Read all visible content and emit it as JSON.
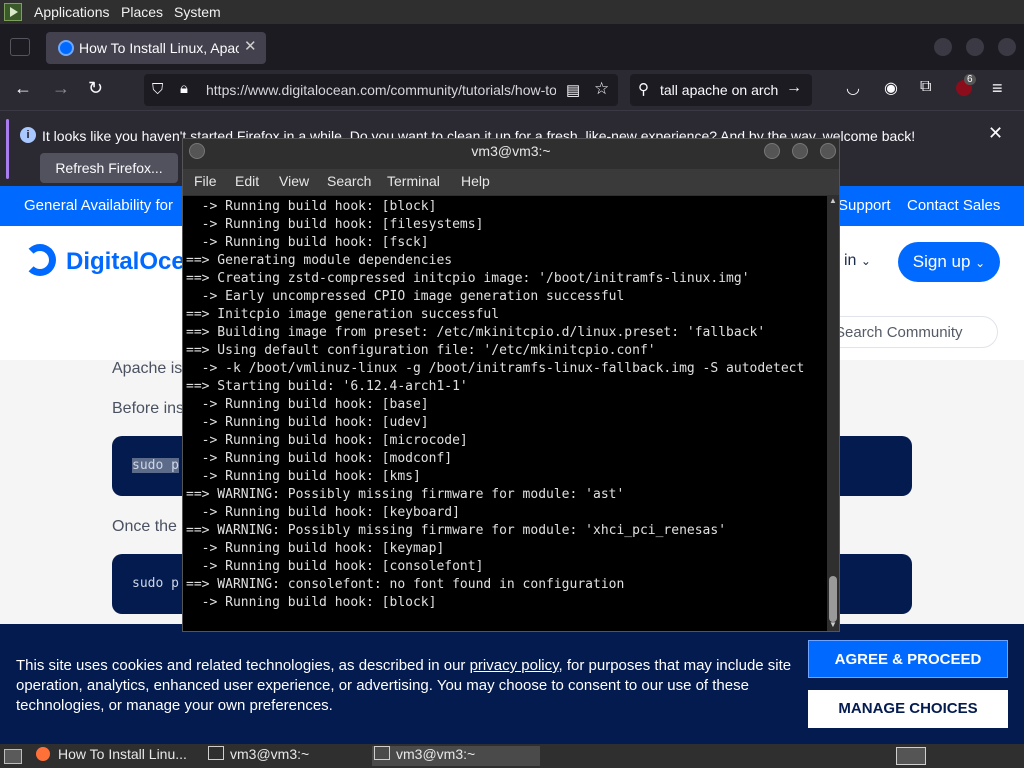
{
  "top_panel": {
    "menus": [
      "Applications",
      "Places",
      "System"
    ]
  },
  "browser": {
    "tab_title": "How To Install Linux, Apache, MySQL, PHP",
    "url": "https://www.digitalocean.com/community/tutorials/how-to-install-linux-apache",
    "search_text": "tall apache on arch",
    "extension_badge": "6",
    "notice": "It looks like you haven't started Firefox in a while. Do you want to clean it up for a fresh, like-new experience? And by the way, welcome back!",
    "refresh_label": "Refresh Firefox..."
  },
  "page": {
    "banner_left": "General Availability for",
    "banner_support": "Support",
    "banner_contact": "Contact Sales",
    "logo_text": "DigitalOce",
    "signin_text": "in",
    "signup_label": "Sign up",
    "search_placeholder": "Search Community",
    "para1": "Apache is",
    "para2": "Before ins",
    "para3": "Once the",
    "code1": "sudo p",
    "code2": "sudo p"
  },
  "cookie": {
    "text_before": "This site uses cookies and related technologies, as described in our ",
    "link": "privacy policy",
    "text_after": ", for purposes that may include site operation, analytics, enhanced user experience, or advertising. You may choose to consent to our use of these technologies, or manage your own preferences.",
    "agree": "AGREE & PROCEED",
    "manage": "MANAGE CHOICES"
  },
  "terminal": {
    "title": "vm3@vm3:~",
    "menus": [
      "File",
      "Edit",
      "View",
      "Search",
      "Terminal",
      "Help"
    ],
    "lines": [
      "  -> Running build hook: [block]",
      "  -> Running build hook: [filesystems]",
      "  -> Running build hook: [fsck]",
      "==> Generating module dependencies",
      "==> Creating zstd-compressed initcpio image: '/boot/initramfs-linux.img'",
      "  -> Early uncompressed CPIO image generation successful",
      "==> Initcpio image generation successful",
      "==> Building image from preset: /etc/mkinitcpio.d/linux.preset: 'fallback'",
      "==> Using default configuration file: '/etc/mkinitcpio.conf'",
      "  -> -k /boot/vmlinuz-linux -g /boot/initramfs-linux-fallback.img -S autodetect",
      "==> Starting build: '6.12.4-arch1-1'",
      "  -> Running build hook: [base]",
      "  -> Running build hook: [udev]",
      "  -> Running build hook: [microcode]",
      "  -> Running build hook: [modconf]",
      "  -> Running build hook: [kms]",
      "==> WARNING: Possibly missing firmware for module: 'ast'",
      "  -> Running build hook: [keyboard]",
      "==> WARNING: Possibly missing firmware for module: 'xhci_pci_renesas'",
      "  -> Running build hook: [keymap]",
      "  -> Running build hook: [consolefont]",
      "==> WARNING: consolefont: no font found in configuration",
      "  -> Running build hook: [block]"
    ]
  },
  "taskbar": {
    "tasks": [
      "How To Install Linu...",
      "vm3@vm3:~",
      "vm3@vm3:~"
    ]
  }
}
